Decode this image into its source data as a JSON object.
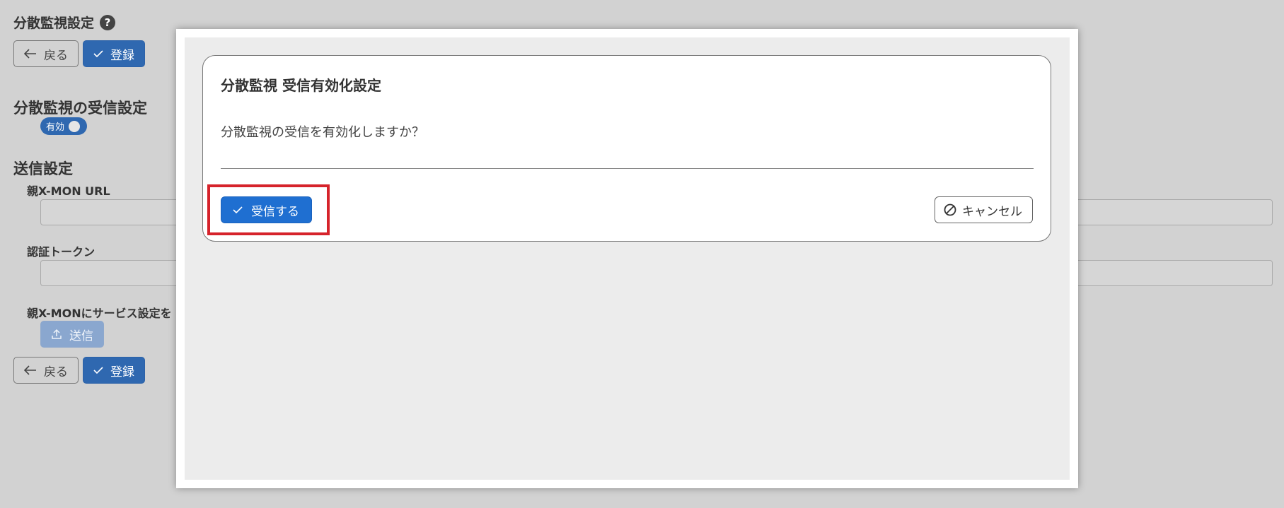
{
  "page": {
    "title": "分散監視設定",
    "help_glyph": "?",
    "back_label": "戻る",
    "register_label": "登録"
  },
  "receive_settings": {
    "title": "分散監視の受信設定",
    "toggle_label": "有効",
    "toggle_state": "on"
  },
  "send_settings": {
    "title": "送信設定",
    "parent_url_label": "親X-MON URL",
    "parent_url_value": "",
    "auth_token_label": "認証トークン",
    "auth_token_value": "",
    "service_label": "親X-MONにサービス設定を",
    "send_label": "送信"
  },
  "dialog": {
    "title": "分散監視 受信有効化設定",
    "message": "分散監視の受信を有効化しますか？",
    "confirm_label": "受信する",
    "cancel_label": "キャンセル"
  },
  "colors": {
    "primary": "#2f68b0",
    "confirm": "#1f6fd1",
    "highlight": "#d6232b",
    "overlay_bg": "#d2d2d2"
  }
}
